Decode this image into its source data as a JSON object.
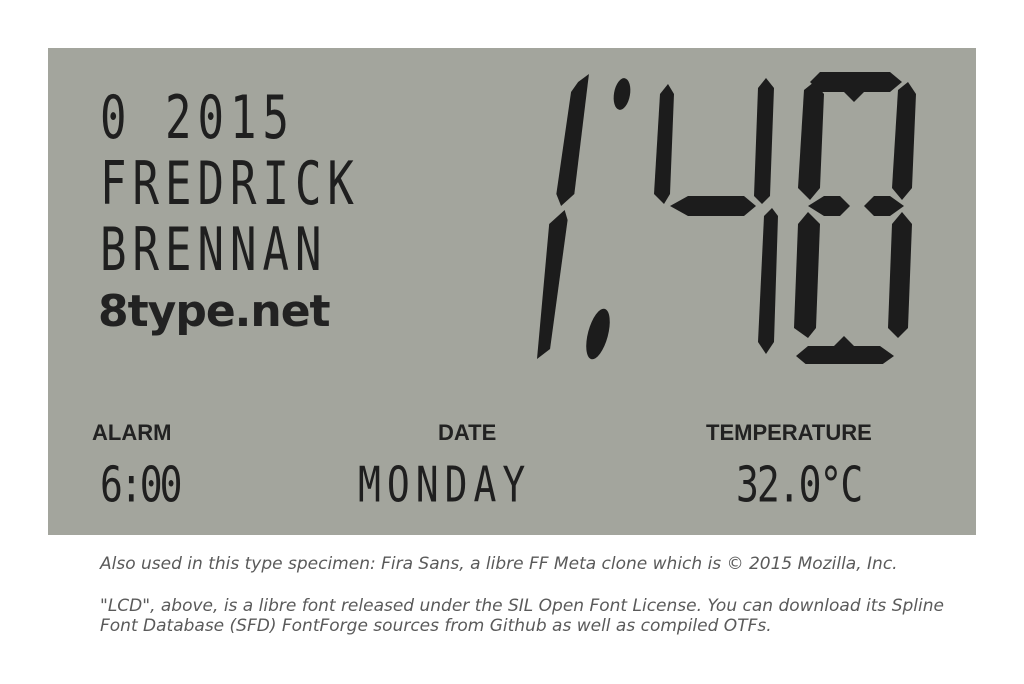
{
  "lcd": {
    "line1": "0 2015",
    "line2": "FREDRICK",
    "line3": "BRENNAN",
    "site": "8type.net",
    "big_time": "1:48",
    "labels": {
      "alarm": "ALARM",
      "date": "DATE",
      "temperature": "TEMPERATURE"
    },
    "values": {
      "alarm": "6:00",
      "date": "MONDAY",
      "temperature": "32.0°C"
    },
    "colors": {
      "panel": "#a3a59d",
      "segment": "#1c1c1c"
    }
  },
  "notes": {
    "line1": "Also used in this type specimen: Fira Sans, a libre FF Meta clone which is © 2015 Mozilla, Inc.",
    "line2": "\"LCD\", above, is a libre font released under the SIL Open Font License. You can download its Spline Font Database (SFD) FontForge sources from Github as well as compiled OTFs."
  }
}
